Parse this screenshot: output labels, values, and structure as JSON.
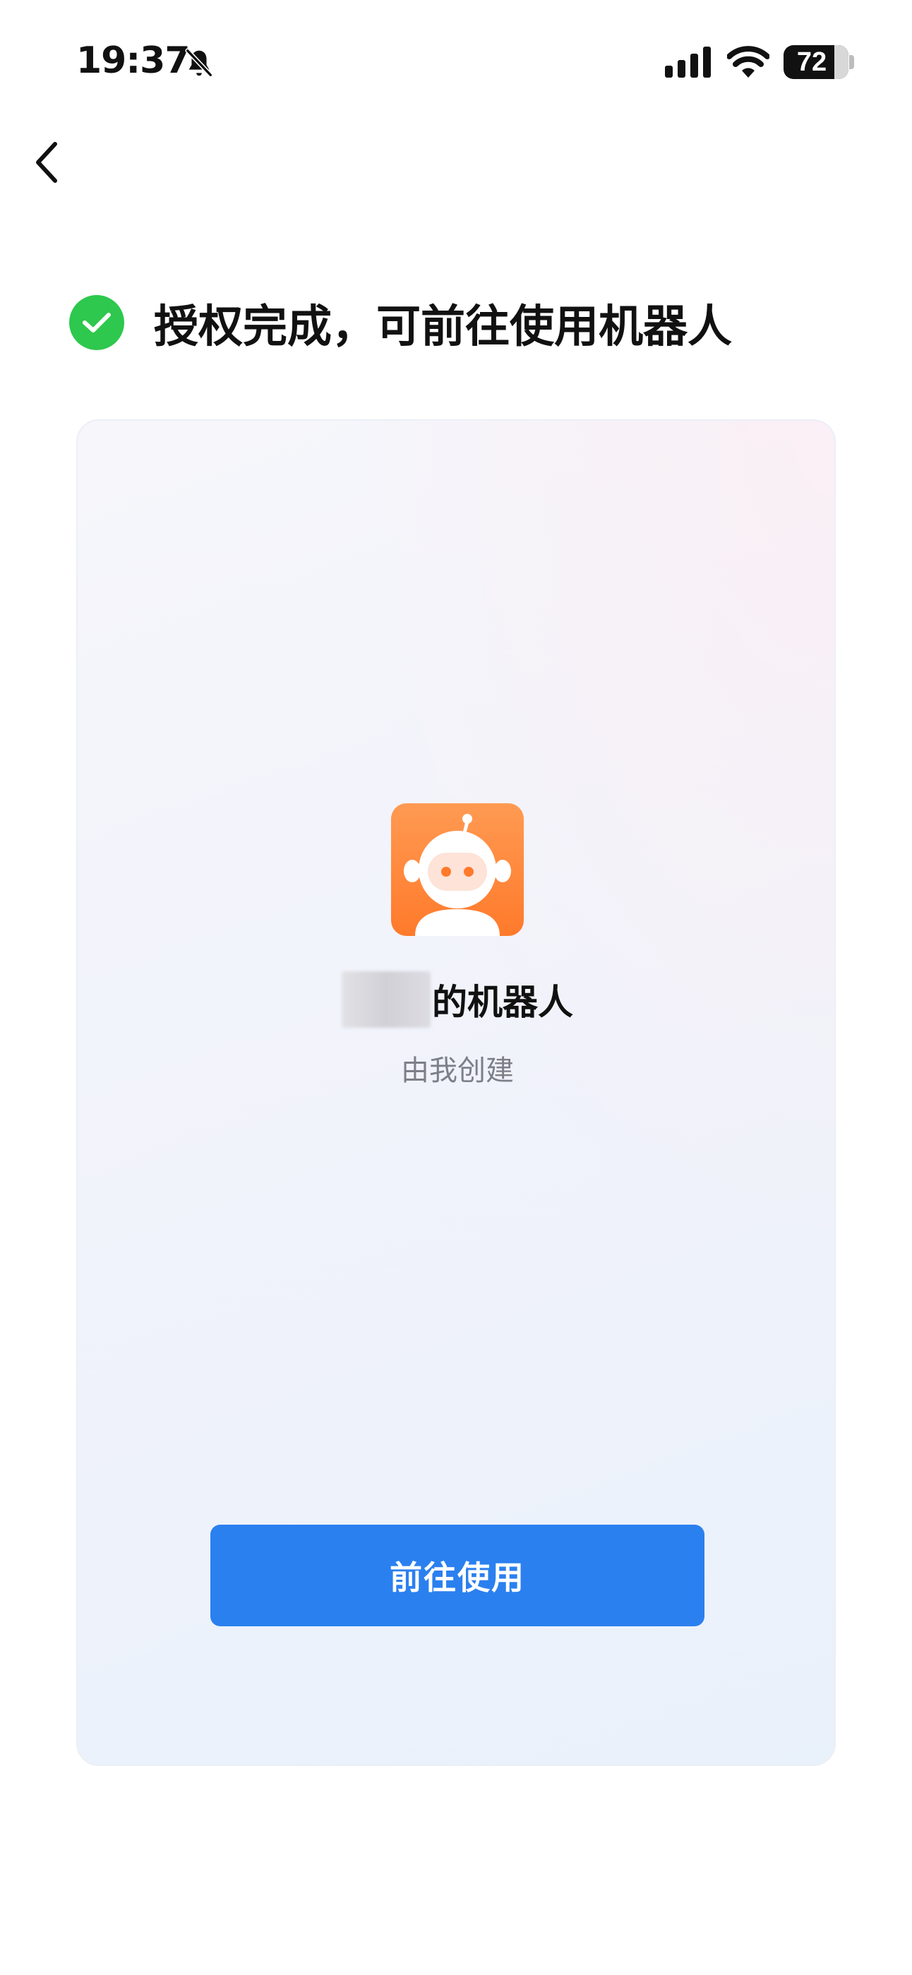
{
  "status_bar": {
    "time": "19:37",
    "battery_level": "72",
    "icons": [
      "bell-slash-icon",
      "cellular-signal-icon",
      "wifi-icon",
      "battery-icon"
    ]
  },
  "nav": {
    "back_icon": "chevron-left-icon"
  },
  "headline": {
    "icon": "check-circle-icon",
    "text": "授权完成，可前往使用机器人",
    "icon_color": "#2dc84d"
  },
  "card": {
    "avatar_icon": "robot-icon",
    "bot_name_suffix": "的机器人",
    "creator": "由我创建",
    "primary_button_label": "前往使用",
    "primary_button_color": "#2b80ef",
    "avatar_color": "#ff7a2b"
  }
}
